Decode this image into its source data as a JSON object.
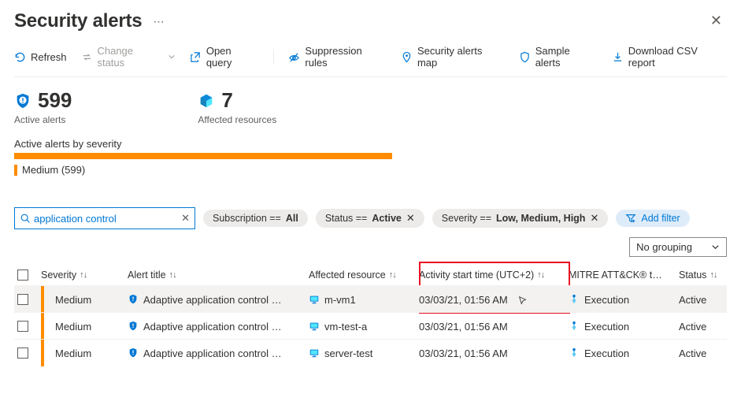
{
  "header": {
    "title": "Security alerts"
  },
  "toolbar": {
    "refresh": "Refresh",
    "change_status": "Change status",
    "open_query": "Open query",
    "suppression_rules": "Suppression rules",
    "alerts_map": "Security alerts map",
    "sample_alerts": "Sample alerts",
    "download_csv": "Download CSV report"
  },
  "metrics": {
    "active_alerts_value": "599",
    "active_alerts_label": "Active alerts",
    "affected_resources_value": "7",
    "affected_resources_label": "Affected resources"
  },
  "severity": {
    "title": "Active alerts by severity",
    "legend_label": "Medium (599)"
  },
  "filters": {
    "search_value": "application control",
    "subscription_prefix": "Subscription == ",
    "subscription_value": "All",
    "status_prefix": "Status == ",
    "status_value": "Active",
    "severity_prefix": "Severity == ",
    "severity_value": "Low, Medium, High",
    "add_filter_label": "Add filter"
  },
  "grouping": {
    "selected": "No grouping"
  },
  "columns": {
    "severity": "Severity",
    "alert_title": "Alert title",
    "affected_resource": "Affected resource",
    "activity_start": "Activity start time (UTC+2)",
    "mitre": "MITRE ATT&CK® t…",
    "status": "Status"
  },
  "rows": [
    {
      "severity": "Medium",
      "title": "Adaptive application control …",
      "resource": "m-vm1",
      "time": "03/03/21, 01:56 AM",
      "mitre": "Execution",
      "status": "Active"
    },
    {
      "severity": "Medium",
      "title": "Adaptive application control …",
      "resource": "vm-test-a",
      "time": "03/03/21, 01:56 AM",
      "mitre": "Execution",
      "status": "Active"
    },
    {
      "severity": "Medium",
      "title": "Adaptive application control …",
      "resource": "server-test",
      "time": "03/03/21, 01:56 AM",
      "mitre": "Execution",
      "status": "Active"
    }
  ]
}
